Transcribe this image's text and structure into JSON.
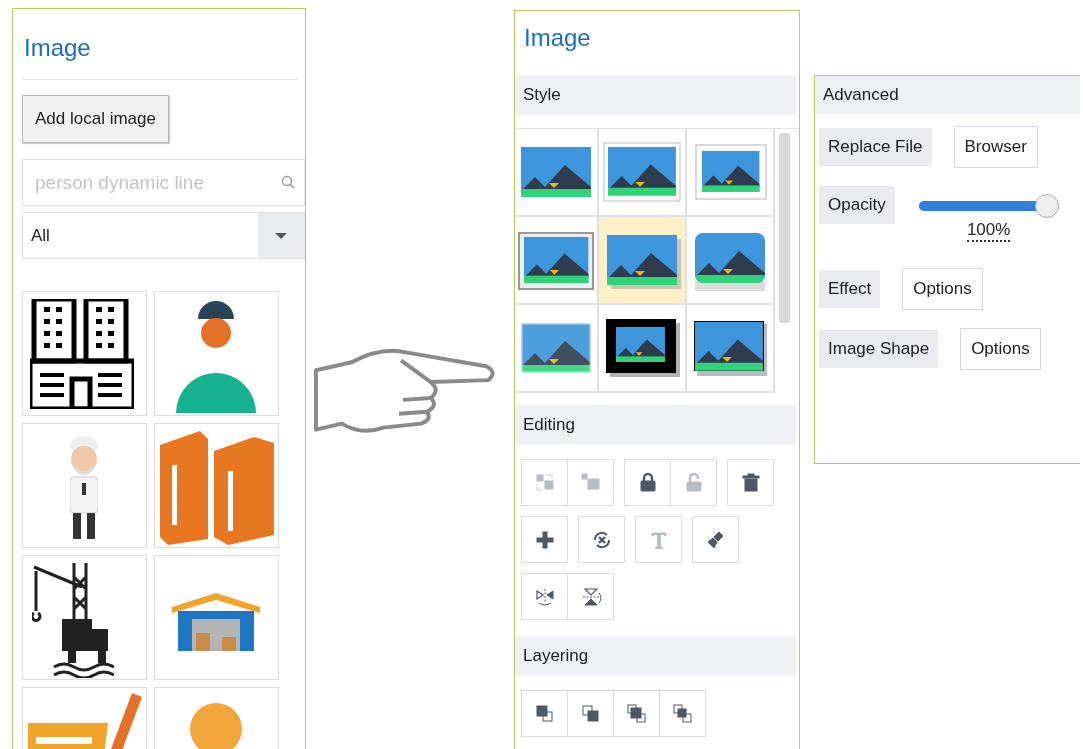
{
  "library_panel": {
    "title": "Image",
    "add_button": "Add local image",
    "search": {
      "placeholder": "person dynamic line"
    },
    "category": {
      "value": "All"
    },
    "thumbnails": [
      {
        "kind": "building"
      },
      {
        "kind": "worker"
      },
      {
        "kind": "chef"
      },
      {
        "kind": "books"
      },
      {
        "kind": "oil-rig"
      },
      {
        "kind": "warehouse"
      },
      {
        "kind": "sign"
      },
      {
        "kind": "person"
      }
    ]
  },
  "format_panel": {
    "title": "Image",
    "style": {
      "title": "Style",
      "styles": [
        {
          "kind": "plain",
          "selected": false
        },
        {
          "kind": "thin-frame",
          "selected": false
        },
        {
          "kind": "white-frame",
          "selected": false
        },
        {
          "kind": "bevel",
          "selected": false
        },
        {
          "kind": "drop-shadow",
          "selected": true
        },
        {
          "kind": "rounded-reflection",
          "selected": false
        },
        {
          "kind": "soft-edge",
          "selected": false
        },
        {
          "kind": "thick-black-frame",
          "selected": false
        },
        {
          "kind": "black-border",
          "selected": false
        }
      ]
    },
    "editing": {
      "title": "Editing",
      "rows": [
        {
          "groups": [
            {
              "tools": [
                {
                  "kind": "group",
                  "disabled": true
                },
                {
                  "kind": "ungroup",
                  "disabled": true
                }
              ]
            },
            {
              "tools": [
                {
                  "kind": "lock",
                  "disabled": false
                },
                {
                  "kind": "unlock",
                  "disabled": true
                }
              ]
            },
            {
              "tools": [
                {
                  "kind": "delete",
                  "disabled": false
                }
              ]
            }
          ]
        },
        {
          "groups": [
            {
              "tools": [
                {
                  "kind": "add",
                  "disabled": false
                }
              ]
            },
            {
              "tools": [
                {
                  "kind": "reset",
                  "disabled": false
                }
              ]
            },
            {
              "tools": [
                {
                  "kind": "text",
                  "disabled": true
                }
              ]
            },
            {
              "tools": [
                {
                  "kind": "brush",
                  "disabled": false
                }
              ]
            }
          ]
        },
        {
          "groups": [
            {
              "tools": [
                {
                  "kind": "flip-horizontal",
                  "disabled": false
                },
                {
                  "kind": "flip-vertical",
                  "disabled": false
                }
              ]
            }
          ]
        }
      ]
    },
    "layering": {
      "title": "Layering",
      "tools": [
        {
          "kind": "bring-to-front"
        },
        {
          "kind": "send-to-back"
        },
        {
          "kind": "bring-forward"
        },
        {
          "kind": "send-backward"
        }
      ]
    }
  },
  "advanced_panel": {
    "title": "Advanced",
    "rows": [
      {
        "kind": "button",
        "label": "Replace File",
        "button": "Browser"
      },
      {
        "kind": "slider",
        "label": "Opacity",
        "level": 1,
        "reading": "100%"
      },
      {
        "kind": "button",
        "label": "Effect",
        "button": "Options"
      },
      {
        "kind": "button",
        "label": "Image Shape",
        "button": "Options"
      }
    ]
  }
}
